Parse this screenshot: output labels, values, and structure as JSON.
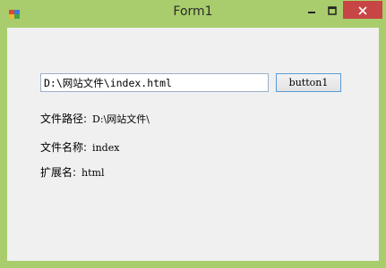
{
  "window": {
    "title": "Form1",
    "controls": {
      "minimize": "minimize",
      "maximize": "maximize",
      "close": "close"
    }
  },
  "form": {
    "path_input_value": "D:\\网站文件\\index.html",
    "button_label": "button1",
    "rows": [
      {
        "label": "文件路径:",
        "value": "D:\\网站文件\\"
      },
      {
        "label": "文件名称:",
        "value": "index"
      },
      {
        "label": "扩展名:",
        "value": "html"
      }
    ]
  },
  "colors": {
    "frame": "#a9cd6c",
    "client": "#f0f0f0",
    "close_button": "#c74545",
    "button_border": "#5a9bd8"
  }
}
